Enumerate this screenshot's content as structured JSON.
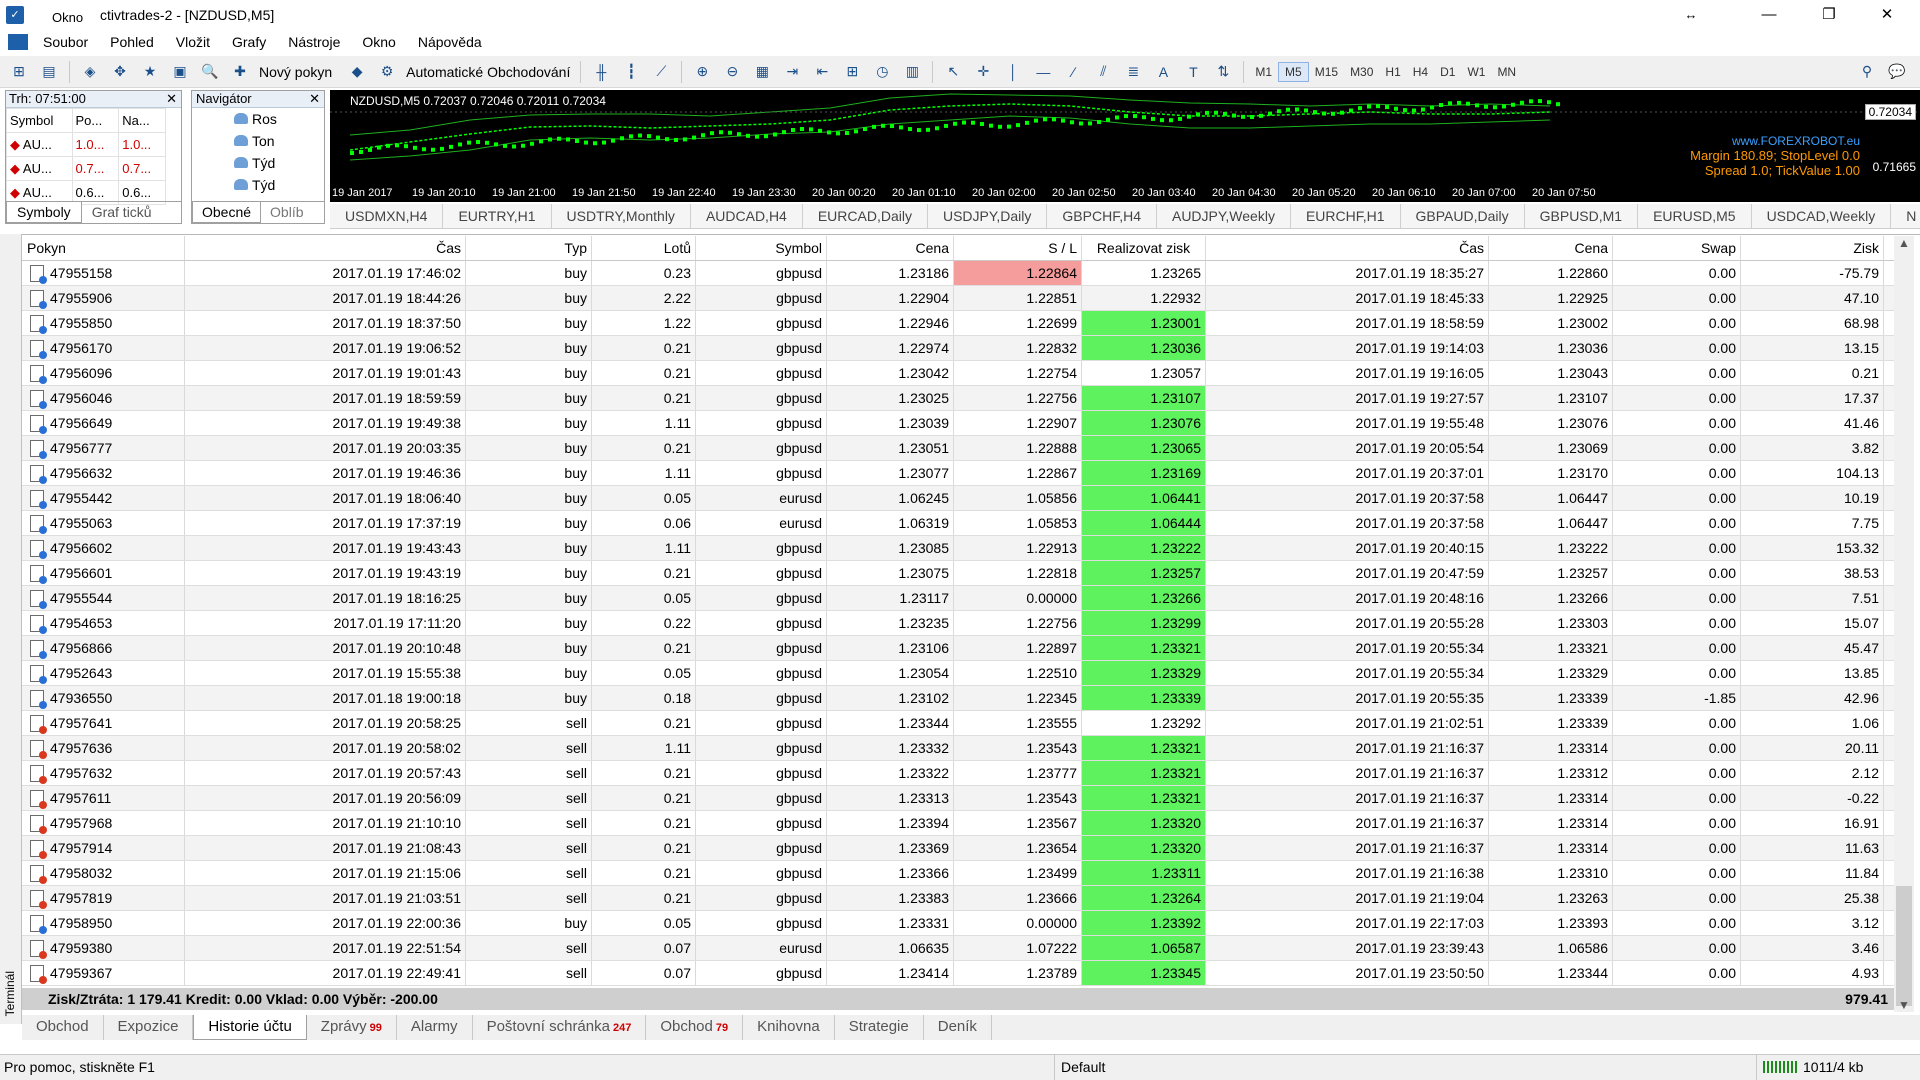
{
  "window": {
    "title": "ctivtrades-2 - [NZDUSD,M5]",
    "overlay_label": "Okno",
    "minimize": "—",
    "maximize": "❐",
    "close": "✕",
    "restore_arrows": "↔"
  },
  "menu": [
    "Soubor",
    "Pohled",
    "Vložit",
    "Grafy",
    "Nástroje",
    "Okno",
    "Nápověda"
  ],
  "toolbar": {
    "new_order": "Nový pokyn",
    "auto_trading": "Automatické Obchodování",
    "timeframes": [
      "M1",
      "M5",
      "M15",
      "M30",
      "H1",
      "H4",
      "D1",
      "W1",
      "MN"
    ],
    "active_timeframe": "M5"
  },
  "market_watch": {
    "title": "Trh: 07:51:00",
    "close": "✕",
    "headers": [
      "Symbol",
      "Po...",
      "Na..."
    ],
    "rows": [
      [
        "AU...",
        "1.0...",
        "1.0..."
      ],
      [
        "AU...",
        "0.7...",
        "0.7..."
      ],
      [
        "AU...",
        "0.6...",
        "0.6..."
      ]
    ],
    "tabs": [
      "Symboly",
      "Graf ticků"
    ]
  },
  "navigator": {
    "title": "Navigátor",
    "close": "✕",
    "items": [
      "Ros",
      "Ton",
      "Týd",
      "Týd"
    ],
    "tabs": [
      "Obecné",
      "Oblíb"
    ]
  },
  "chart": {
    "info": "NZDUSD,M5  0.72037 0.72046 0.72011 0.72034",
    "price_current": "0.72034",
    "price_low": "0.71665",
    "watermark": "www.FOREXROBOT.eu",
    "margin_line": "Margin 180.89; StopLevel 0.0",
    "spread_line": "Spread 1.0; TickValue 1.00",
    "time_labels": [
      "19 Jan 2017",
      "19 Jan 20:10",
      "19 Jan 21:00",
      "19 Jan 21:50",
      "19 Jan 22:40",
      "19 Jan 23:30",
      "20 Jan 00:20",
      "20 Jan 01:10",
      "20 Jan 02:00",
      "20 Jan 02:50",
      "20 Jan 03:40",
      "20 Jan 04:30",
      "20 Jan 05:20",
      "20 Jan 06:10",
      "20 Jan 07:00",
      "20 Jan 07:50"
    ]
  },
  "chart_tabs": [
    "USDMXN,H4",
    "EURTRY,H1",
    "USDTRY,Monthly",
    "AUDCAD,H4",
    "EURCAD,Daily",
    "USDJPY,Daily",
    "GBPCHF,H4",
    "AUDJPY,Weekly",
    "EURCHF,H1",
    "GBPAUD,Daily",
    "GBPUSD,M1",
    "EURUSD,M5",
    "USDCAD,Weekly",
    "N"
  ],
  "history": {
    "headers": [
      "Pokyn",
      "Čas",
      "Typ",
      "Lotů",
      "Symbol",
      "Cena",
      "S / L",
      "Realizovat zisk",
      "Čas",
      "Cena",
      "Swap",
      "Zisk"
    ],
    "rows": [
      [
        "47955158",
        "2017.01.19 17:46:02",
        "buy",
        "0.23",
        "gbpusd",
        "1.23186",
        "1.22864",
        "1.23265",
        "2017.01.19 18:35:27",
        "1.22860",
        "0.00",
        "-75.79",
        "pink",
        ""
      ],
      [
        "47955906",
        "2017.01.19 18:44:26",
        "buy",
        "2.22",
        "gbpusd",
        "1.22904",
        "1.22851",
        "1.22932",
        "2017.01.19 18:45:33",
        "1.22925",
        "0.00",
        "47.10",
        "",
        ""
      ],
      [
        "47955850",
        "2017.01.19 18:37:50",
        "buy",
        "1.22",
        "gbpusd",
        "1.22946",
        "1.22699",
        "1.23001",
        "2017.01.19 18:58:59",
        "1.23002",
        "0.00",
        "68.98",
        "",
        "green"
      ],
      [
        "47956170",
        "2017.01.19 19:06:52",
        "buy",
        "0.21",
        "gbpusd",
        "1.22974",
        "1.22832",
        "1.23036",
        "2017.01.19 19:14:03",
        "1.23036",
        "0.00",
        "13.15",
        "",
        "green"
      ],
      [
        "47956096",
        "2017.01.19 19:01:43",
        "buy",
        "0.21",
        "gbpusd",
        "1.23042",
        "1.22754",
        "1.23057",
        "2017.01.19 19:16:05",
        "1.23043",
        "0.00",
        "0.21",
        "",
        ""
      ],
      [
        "47956046",
        "2017.01.19 18:59:59",
        "buy",
        "0.21",
        "gbpusd",
        "1.23025",
        "1.22756",
        "1.23107",
        "2017.01.19 19:27:57",
        "1.23107",
        "0.00",
        "17.37",
        "",
        "green"
      ],
      [
        "47956649",
        "2017.01.19 19:49:38",
        "buy",
        "1.11",
        "gbpusd",
        "1.23039",
        "1.22907",
        "1.23076",
        "2017.01.19 19:55:48",
        "1.23076",
        "0.00",
        "41.46",
        "",
        "green"
      ],
      [
        "47956777",
        "2017.01.19 20:03:35",
        "buy",
        "0.21",
        "gbpusd",
        "1.23051",
        "1.22888",
        "1.23065",
        "2017.01.19 20:05:54",
        "1.23069",
        "0.00",
        "3.82",
        "",
        "green"
      ],
      [
        "47956632",
        "2017.01.19 19:46:36",
        "buy",
        "1.11",
        "gbpusd",
        "1.23077",
        "1.22867",
        "1.23169",
        "2017.01.19 20:37:01",
        "1.23170",
        "0.00",
        "104.13",
        "",
        "green"
      ],
      [
        "47955442",
        "2017.01.19 18:06:40",
        "buy",
        "0.05",
        "eurusd",
        "1.06245",
        "1.05856",
        "1.06441",
        "2017.01.19 20:37:58",
        "1.06447",
        "0.00",
        "10.19",
        "",
        "green"
      ],
      [
        "47955063",
        "2017.01.19 17:37:19",
        "buy",
        "0.06",
        "eurusd",
        "1.06319",
        "1.05853",
        "1.06444",
        "2017.01.19 20:37:58",
        "1.06447",
        "0.00",
        "7.75",
        "",
        "green"
      ],
      [
        "47956602",
        "2017.01.19 19:43:43",
        "buy",
        "1.11",
        "gbpusd",
        "1.23085",
        "1.22913",
        "1.23222",
        "2017.01.19 20:40:15",
        "1.23222",
        "0.00",
        "153.32",
        "",
        "green"
      ],
      [
        "47956601",
        "2017.01.19 19:43:19",
        "buy",
        "0.21",
        "gbpusd",
        "1.23075",
        "1.22818",
        "1.23257",
        "2017.01.19 20:47:59",
        "1.23257",
        "0.00",
        "38.53",
        "",
        "green"
      ],
      [
        "47955544",
        "2017.01.19 18:16:25",
        "buy",
        "0.05",
        "gbpusd",
        "1.23117",
        "0.00000",
        "1.23266",
        "2017.01.19 20:48:16",
        "1.23266",
        "0.00",
        "7.51",
        "",
        "green"
      ],
      [
        "47954653",
        "2017.01.19 17:11:20",
        "buy",
        "0.22",
        "gbpusd",
        "1.23235",
        "1.22756",
        "1.23299",
        "2017.01.19 20:55:28",
        "1.23303",
        "0.00",
        "15.07",
        "",
        "green"
      ],
      [
        "47956866",
        "2017.01.19 20:10:48",
        "buy",
        "0.21",
        "gbpusd",
        "1.23106",
        "1.22897",
        "1.23321",
        "2017.01.19 20:55:34",
        "1.23321",
        "0.00",
        "45.47",
        "",
        "green"
      ],
      [
        "47952643",
        "2017.01.19 15:55:38",
        "buy",
        "0.05",
        "gbpusd",
        "1.23054",
        "1.22510",
        "1.23329",
        "2017.01.19 20:55:34",
        "1.23329",
        "0.00",
        "13.85",
        "",
        "green"
      ],
      [
        "47936550",
        "2017.01.18 19:00:18",
        "buy",
        "0.18",
        "gbpusd",
        "1.23102",
        "1.22345",
        "1.23339",
        "2017.01.19 20:55:35",
        "1.23339",
        "-1.85",
        "42.96",
        "",
        "green"
      ],
      [
        "47957641",
        "2017.01.19 20:58:25",
        "sell",
        "0.21",
        "gbpusd",
        "1.23344",
        "1.23555",
        "1.23292",
        "2017.01.19 21:02:51",
        "1.23339",
        "0.00",
        "1.06",
        "",
        ""
      ],
      [
        "47957636",
        "2017.01.19 20:58:02",
        "sell",
        "1.11",
        "gbpusd",
        "1.23332",
        "1.23543",
        "1.23321",
        "2017.01.19 21:16:37",
        "1.23314",
        "0.00",
        "20.11",
        "",
        "green"
      ],
      [
        "47957632",
        "2017.01.19 20:57:43",
        "sell",
        "0.21",
        "gbpusd",
        "1.23322",
        "1.23777",
        "1.23321",
        "2017.01.19 21:16:37",
        "1.23312",
        "0.00",
        "2.12",
        "",
        "green"
      ],
      [
        "47957611",
        "2017.01.19 20:56:09",
        "sell",
        "0.21",
        "gbpusd",
        "1.23313",
        "1.23543",
        "1.23321",
        "2017.01.19 21:16:37",
        "1.23314",
        "0.00",
        "-0.22",
        "",
        "green"
      ],
      [
        "47957968",
        "2017.01.19 21:10:10",
        "sell",
        "0.21",
        "gbpusd",
        "1.23394",
        "1.23567",
        "1.23320",
        "2017.01.19 21:16:37",
        "1.23314",
        "0.00",
        "16.91",
        "",
        "green"
      ],
      [
        "47957914",
        "2017.01.19 21:08:43",
        "sell",
        "0.21",
        "gbpusd",
        "1.23369",
        "1.23654",
        "1.23320",
        "2017.01.19 21:16:37",
        "1.23314",
        "0.00",
        "11.63",
        "",
        "green"
      ],
      [
        "47958032",
        "2017.01.19 21:15:06",
        "sell",
        "0.21",
        "gbpusd",
        "1.23366",
        "1.23499",
        "1.23311",
        "2017.01.19 21:16:38",
        "1.23310",
        "0.00",
        "11.84",
        "",
        "green"
      ],
      [
        "47957819",
        "2017.01.19 21:03:51",
        "sell",
        "0.21",
        "gbpusd",
        "1.23383",
        "1.23666",
        "1.23264",
        "2017.01.19 21:19:04",
        "1.23263",
        "0.00",
        "25.38",
        "",
        "green"
      ],
      [
        "47958950",
        "2017.01.19 22:00:36",
        "buy",
        "0.05",
        "gbpusd",
        "1.23331",
        "0.00000",
        "1.23392",
        "2017.01.19 22:17:03",
        "1.23393",
        "0.00",
        "3.12",
        "",
        "green"
      ],
      [
        "47959380",
        "2017.01.19 22:51:54",
        "sell",
        "0.07",
        "eurusd",
        "1.06635",
        "1.07222",
        "1.06587",
        "2017.01.19 23:39:43",
        "1.06586",
        "0.00",
        "3.46",
        "",
        "green"
      ],
      [
        "47959367",
        "2017.01.19 22:49:41",
        "sell",
        "0.07",
        "gbpusd",
        "1.23414",
        "1.23789",
        "1.23345",
        "2017.01.19 23:50:50",
        "1.23344",
        "0.00",
        "4.93",
        "",
        "green"
      ]
    ],
    "summary": "Zisk/Ztráta: 1 179.41  Kredit: 0.00  Vklad: 0.00  Výběr: -200.00",
    "summary_profit": "979.41"
  },
  "terminal_label": "Terminál",
  "terminal_tabs": [
    {
      "label": "Obchod",
      "badge": ""
    },
    {
      "label": "Expozice",
      "badge": ""
    },
    {
      "label": "Historie účtu",
      "badge": ""
    },
    {
      "label": "Zprávy",
      "badge": "99"
    },
    {
      "label": "Alarmy",
      "badge": ""
    },
    {
      "label": "Poštovní schránka",
      "badge": "247"
    },
    {
      "label": "Obchod",
      "badge": "79"
    },
    {
      "label": "Knihovna",
      "badge": ""
    },
    {
      "label": "Strategie",
      "badge": ""
    },
    {
      "label": "Deník",
      "badge": ""
    }
  ],
  "active_terminal_tab": "Historie účtu",
  "status": {
    "help": "Pro pomoc, stiskněte F1",
    "profile": "Default",
    "traffic": "1011/4 kb"
  },
  "colors": {
    "tp_hit": "#5ef25e",
    "sl_hit": "#f59c9c",
    "chart_bg": "#000000",
    "candles": "#00ff00"
  }
}
